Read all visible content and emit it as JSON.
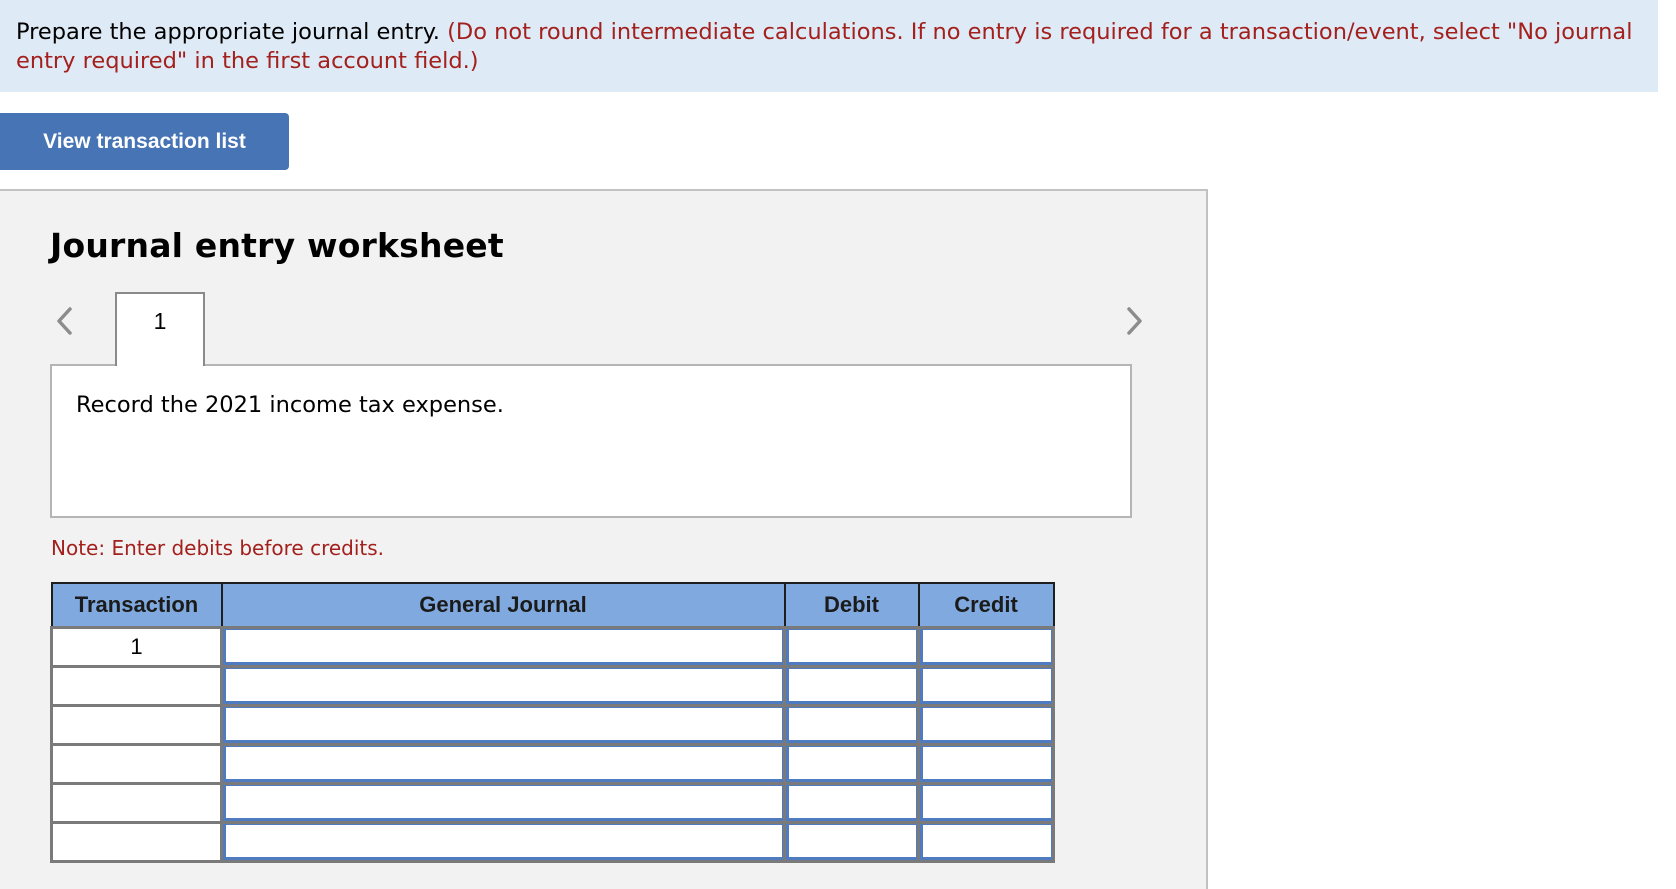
{
  "instructions": {
    "main": "Prepare the appropriate journal entry.",
    "note": "(Do not round intermediate calculations. If no entry is required for a transaction/event, select \"No journal entry required\" in the first account field.)"
  },
  "toolbar": {
    "view_transactions_label": "View transaction list"
  },
  "worksheet": {
    "title": "Journal entry worksheet",
    "prev_icon": "chevron-left-icon",
    "next_icon": "chevron-right-icon",
    "tabs": [
      {
        "label": "1",
        "active": true
      }
    ],
    "description": "Record the 2021 income tax expense.",
    "note": "Note: Enter debits before credits.",
    "table": {
      "headers": {
        "transaction": "Transaction",
        "general_journal": "General Journal",
        "debit": "Debit",
        "credit": "Credit"
      },
      "rows": [
        {
          "transaction": "1",
          "account": "",
          "debit": "",
          "credit": ""
        },
        {
          "transaction": "",
          "account": "",
          "debit": "",
          "credit": ""
        },
        {
          "transaction": "",
          "account": "",
          "debit": "",
          "credit": ""
        },
        {
          "transaction": "",
          "account": "",
          "debit": "",
          "credit": ""
        },
        {
          "transaction": "",
          "account": "",
          "debit": "",
          "credit": ""
        },
        {
          "transaction": "",
          "account": "",
          "debit": "",
          "credit": ""
        }
      ]
    }
  },
  "colors": {
    "banner_bg": "#deeaf6",
    "instruction_red": "#a3201d",
    "button_blue": "#4674b5",
    "header_blue": "#80aadf",
    "panel_bg": "#f2f2f2"
  }
}
